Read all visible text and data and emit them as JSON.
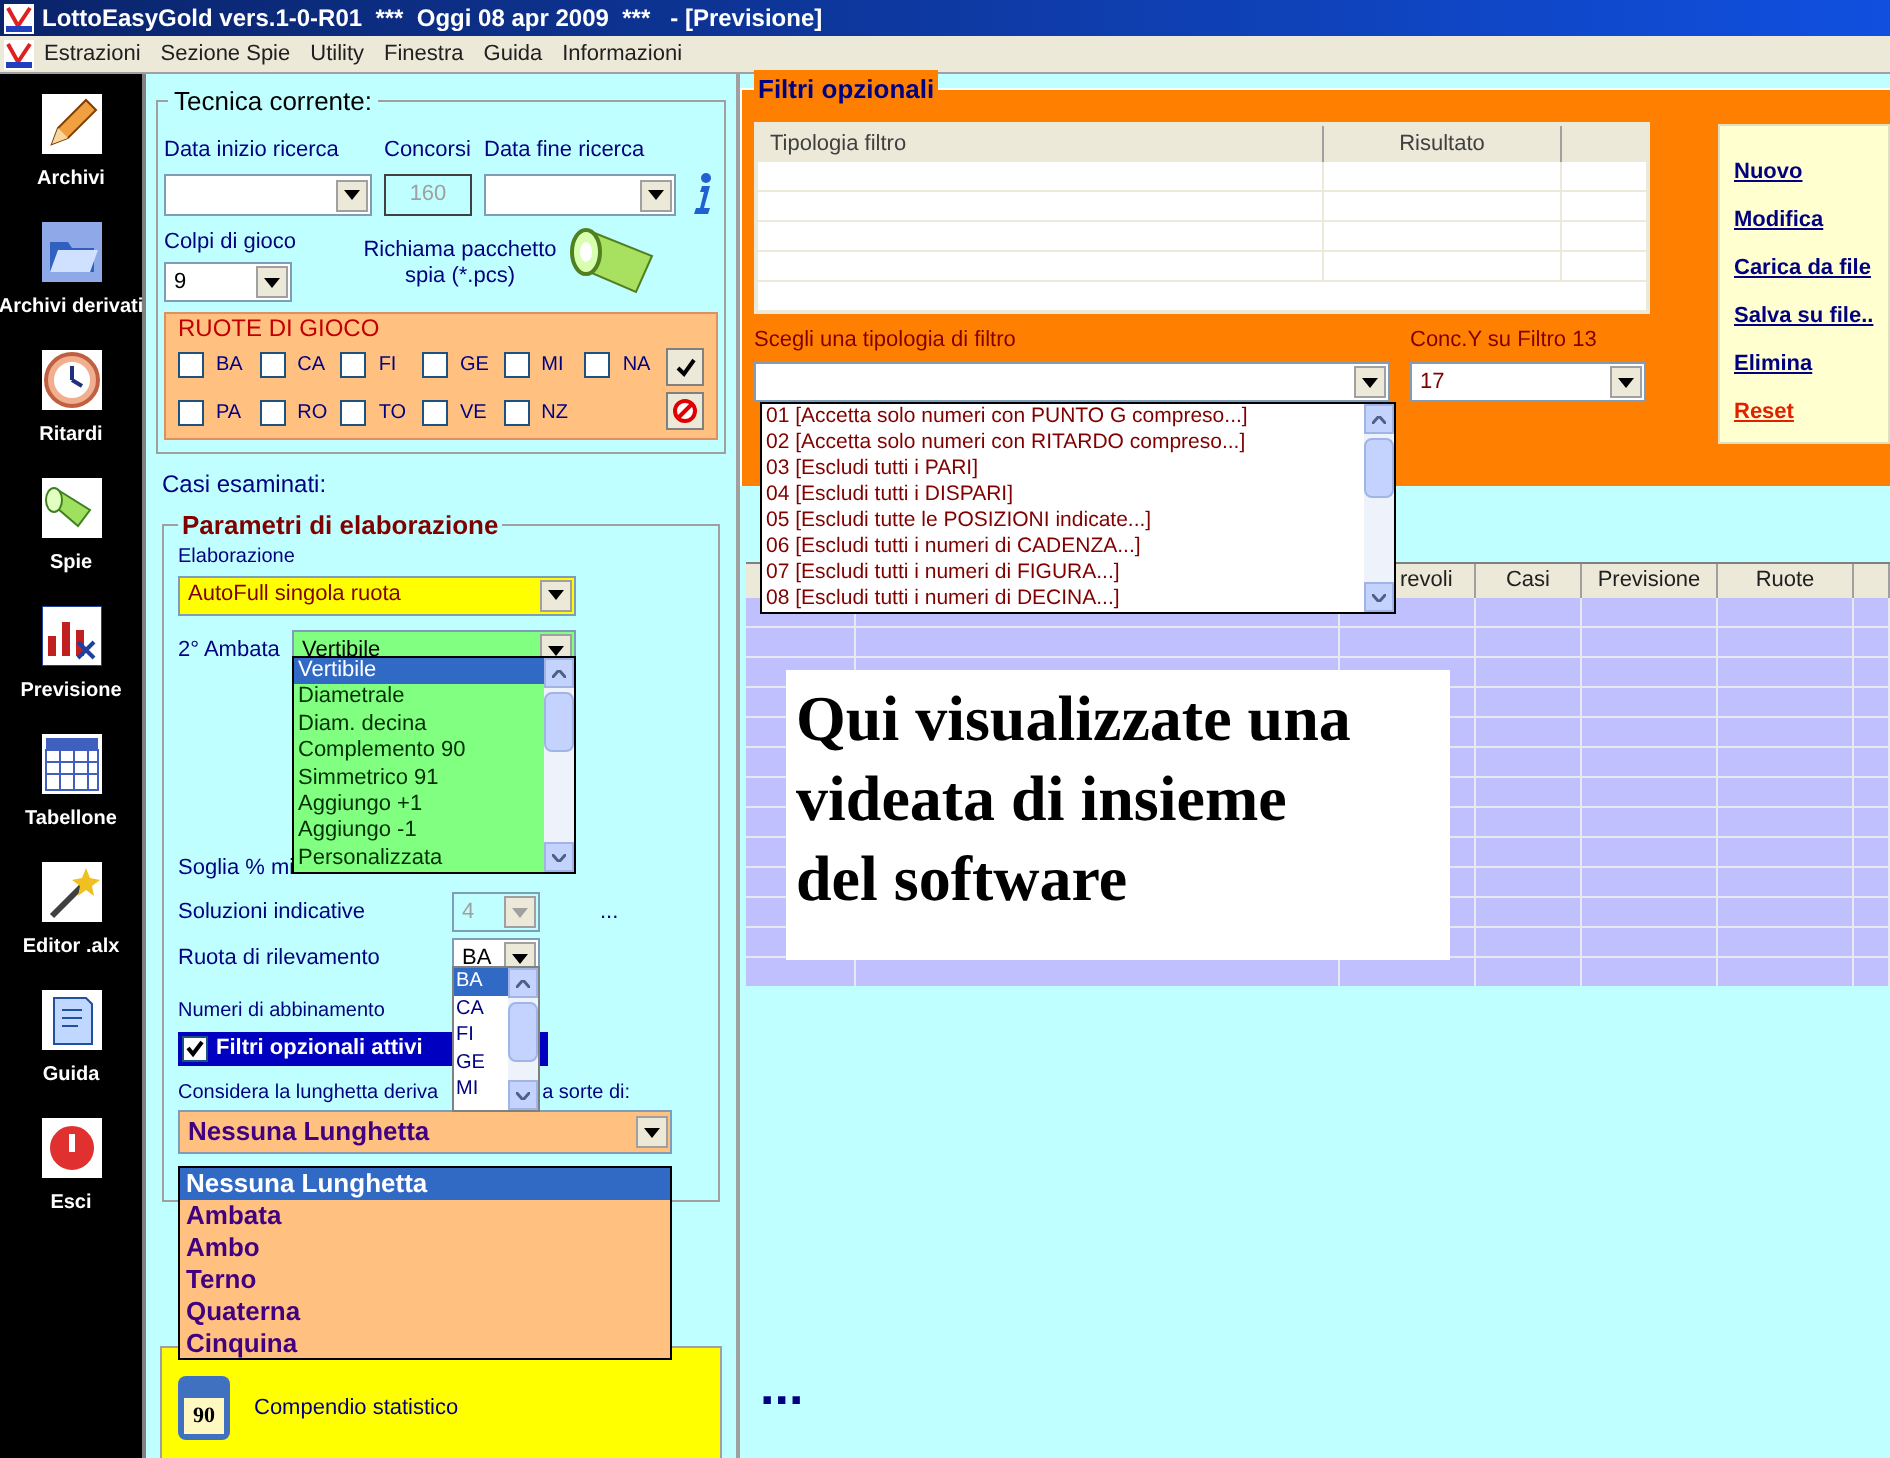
{
  "window": {
    "title": "LottoEasyGold vers.1-0-R01  ***  Oggi 08 apr 2009  ***   - [Previsione]"
  },
  "menu": [
    "Estrazioni",
    "Sezione Spie",
    "Utility",
    "Finestra",
    "Guida",
    "Informazioni"
  ],
  "sidebar": {
    "items": [
      {
        "label": "Archivi"
      },
      {
        "label": "Archivi derivati"
      },
      {
        "label": "Ritardi"
      },
      {
        "label": "Spie"
      },
      {
        "label": "Previsione"
      },
      {
        "label": "Tabellone"
      },
      {
        "label": "Editor .alx"
      },
      {
        "label": "Guida"
      },
      {
        "label": "Esci"
      }
    ]
  },
  "tecnica": {
    "title": "Tecnica corrente:",
    "data_inizio_label": "Data inizio ricerca",
    "concorsi": {
      "label": "Concorsi",
      "value": "160",
      "disabled": true
    },
    "data_fine_label": "Data fine ricerca",
    "colpi": {
      "label": "Colpi di gioco",
      "value": "9"
    },
    "richiama": "Richiama pacchetto spia (*.pcs)"
  },
  "ruote": {
    "title": "RUOTE DI GIOCO",
    "wheels": [
      {
        "label": "BA",
        "checked": false
      },
      {
        "label": "CA",
        "checked": false
      },
      {
        "label": "FI",
        "checked": false
      },
      {
        "label": "GE",
        "checked": false
      },
      {
        "label": "MI",
        "checked": false
      },
      {
        "label": "NA",
        "checked": false
      },
      {
        "label": "PA",
        "checked": false
      },
      {
        "label": "RO",
        "checked": false
      },
      {
        "label": "TO",
        "checked": false
      },
      {
        "label": "VE",
        "checked": false
      },
      {
        "label": "NZ",
        "checked": false
      }
    ]
  },
  "casi_label": "Casi esaminati:",
  "parametri": {
    "title": "Parametri di elaborazione",
    "elaborazione": {
      "label": "Elaborazione",
      "value": "AutoFull singola ruota"
    },
    "ambata": {
      "label": "2° Ambata",
      "value": "Vertibile",
      "options": [
        {
          "label": "Vertibile",
          "selected": true
        },
        {
          "label": "Diametrale",
          "selected": false
        },
        {
          "label": "Diam. decina",
          "selected": false
        },
        {
          "label": "Complemento 90",
          "selected": false
        },
        {
          "label": "Simmetrico 91",
          "selected": false
        },
        {
          "label": "Aggiungo +1",
          "selected": false
        },
        {
          "label": "Aggiungo -1",
          "selected": false
        },
        {
          "label": "Personalizzata",
          "selected": false
        }
      ]
    },
    "soglia_label": "Soglia % mi",
    "soluzioni": {
      "label": "Soluzioni indicative",
      "value": "4",
      "disabled": true,
      "extra": "..."
    },
    "rilevamento": {
      "label": "Ruota di rilevamento",
      "value": "BA",
      "options": [
        {
          "label": "BA",
          "selected": true
        },
        {
          "label": "CA",
          "selected": false
        },
        {
          "label": "FI",
          "selected": false
        },
        {
          "label": "GE",
          "selected": false
        },
        {
          "label": "MI",
          "selected": false
        }
      ]
    },
    "abbinamento_label": "Numeri di abbinamento",
    "filtri_attivi": {
      "label": "Filtri opzionali attivi",
      "checked": true
    },
    "considera_label": [
      "Considera la lunghetta deriva",
      "a sorte di:"
    ],
    "lunghetta": {
      "value": "Nessuna Lunghetta",
      "options": [
        {
          "label": "Nessuna Lunghetta",
          "selected": true
        },
        {
          "label": "Ambata",
          "selected": false
        },
        {
          "label": "Ambo",
          "selected": false
        },
        {
          "label": "Terno",
          "selected": false
        },
        {
          "label": "Quaterna",
          "selected": false
        },
        {
          "label": "Cinquina",
          "selected": false
        }
      ]
    }
  },
  "compendio": {
    "badge": "90",
    "label": "Compendio statistico"
  },
  "filtri": {
    "title": "Filtri opzionali",
    "columns": [
      "Tipologia filtro",
      "Risultato"
    ],
    "scegli_label": "Scegli una tipologia di filtro",
    "conc": {
      "label": "Conc.Y su Filtro 13",
      "value": "17"
    },
    "options": [
      {
        "label": "01 [Accetta solo numeri con PUNTO G compreso...]",
        "selected": false
      },
      {
        "label": "02 [Accetta solo numeri con RITARDO compreso...]",
        "selected": false
      },
      {
        "label": "03 [Escludi tutti i PARI]",
        "selected": false
      },
      {
        "label": "04 [Escludi tutti i DISPARI]",
        "selected": false
      },
      {
        "label": "05 [Escludi tutte le POSIZIONI indicate...]",
        "selected": false
      },
      {
        "label": "06 [Escludi tutti i numeri di CADENZA...]",
        "selected": false
      },
      {
        "label": "07 [Escludi tutti i numeri di FIGURA...]",
        "selected": false
      },
      {
        "label": "08 [Escludi tutti i numeri di DECINA...]",
        "selected": false
      }
    ],
    "actions": [
      {
        "label": "Nuovo",
        "kind": "link"
      },
      {
        "label": "Modifica",
        "kind": "link"
      },
      {
        "label": "Carica da file",
        "kind": "link"
      },
      {
        "label": "Salva su file..",
        "kind": "link"
      },
      {
        "label": "Elimina",
        "kind": "link"
      },
      {
        "label": "Reset",
        "kind": "danger"
      }
    ]
  },
  "grid": {
    "columns": [
      "revoli",
      "Casi",
      "Previsione",
      "Ruote"
    ]
  },
  "note": "Qui visualizzate una videata di insieme del software",
  "footer": "..."
}
